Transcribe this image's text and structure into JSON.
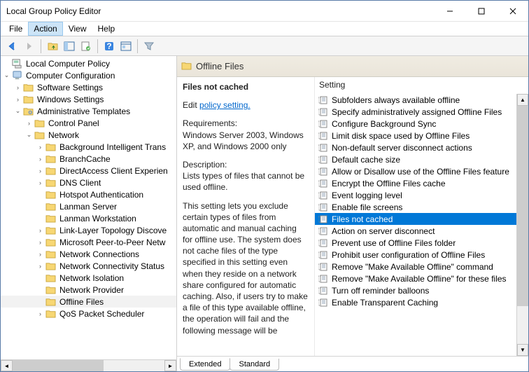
{
  "window": {
    "title": "Local Group Policy Editor"
  },
  "menu": {
    "file": "File",
    "action": "Action",
    "view": "View",
    "help": "Help"
  },
  "tree": {
    "header": "Local Computer Policy",
    "root": "Computer Configuration",
    "soft": "Software Settings",
    "win": "Windows Settings",
    "admin": "Administrative Templates",
    "cp": "Control Panel",
    "net": "Network",
    "items": [
      "Background Intelligent Trans",
      "BranchCache",
      "DirectAccess Client Experien",
      "DNS Client",
      "Hotspot Authentication",
      "Lanman Server",
      "Lanman Workstation",
      "Link-Layer Topology Discove",
      "Microsoft Peer-to-Peer Netw",
      "Network Connections",
      "Network Connectivity Status",
      "Network Isolation",
      "Network Provider",
      "Offline Files",
      "QoS Packet Scheduler"
    ]
  },
  "right": {
    "title": "Offline Files",
    "selected": "Files not cached",
    "edit_prefix": "Edit ",
    "edit_link": "policy setting.",
    "req_label": "Requirements:",
    "req_text": "Windows Server 2003, Windows XP, and Windows 2000 only",
    "desc_label": "Description:",
    "desc_short": "Lists types of files that cannot be used offline.",
    "desc_long": "This setting lets you exclude certain types of files from automatic and manual caching for offline use. The system does not cache files of the type specified in this setting even when they reside on a network share configured for automatic caching. Also, if users try to make a file of this type available offline, the operation will fail and the following message will be"
  },
  "settings": {
    "header": "Setting",
    "items": [
      "Subfolders always available offline",
      "Specify administratively assigned Offline Files",
      "Configure Background Sync",
      "Limit disk space used by Offline Files",
      "Non-default server disconnect actions",
      "Default cache size",
      "Allow or Disallow use of the Offline Files feature",
      "Encrypt the Offline Files cache",
      "Event logging level",
      "Enable file screens",
      "Files not cached",
      "Action on server disconnect",
      "Prevent use of Offline Files folder",
      "Prohibit user configuration of Offline Files",
      "Remove \"Make Available Offline\" command",
      "Remove \"Make Available Offline\" for these files",
      "Turn off reminder balloons",
      "Enable Transparent Caching"
    ]
  },
  "tabs": {
    "extended": "Extended",
    "standard": "Standard"
  }
}
